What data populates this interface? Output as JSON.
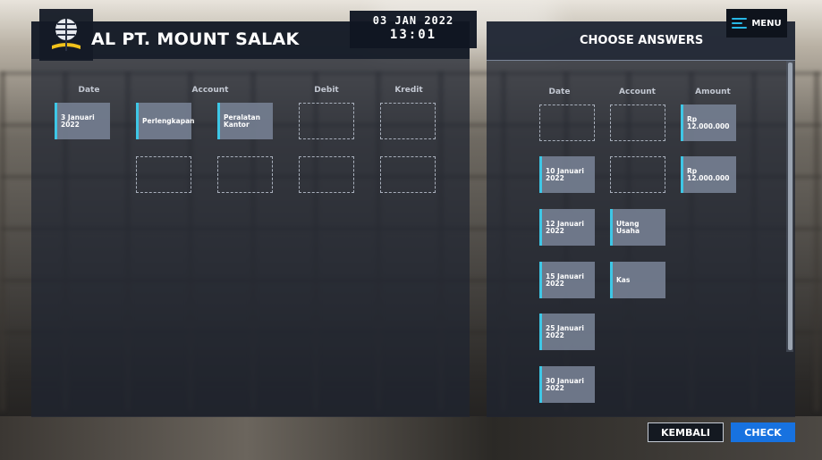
{
  "header": {
    "title": "AL PT. MOUNT SALAK",
    "date": "03 JAN 2022",
    "time": "13:01"
  },
  "menu": {
    "label": "MENU"
  },
  "journal": {
    "columns": [
      "Date",
      "Account",
      "Debit",
      "Kredit"
    ],
    "row1": {
      "date": "3 Januari\n2022",
      "account1": "Perlengkapan",
      "account2": "Peralatan\nKantor"
    }
  },
  "answers": {
    "title": "CHOOSE ANSWERS",
    "columns": [
      "Date",
      "Account",
      "Amount"
    ],
    "dates": [
      "10 Januari\n2022",
      "12 Januari\n2022",
      "15 Januari\n2022",
      "25 Januari\n2022",
      "30 Januari\n2022"
    ],
    "accounts": [
      "Utang\nUsaha",
      "Kas"
    ],
    "amounts": [
      "Rp\n12.000.000",
      "Rp\n12.000.000"
    ]
  },
  "buttons": {
    "back": "KEMBALI",
    "check": "CHECK"
  },
  "colors": {
    "accent": "#3ec7e6",
    "check": "#1772e0",
    "menu_icon": "#27b8e6"
  }
}
